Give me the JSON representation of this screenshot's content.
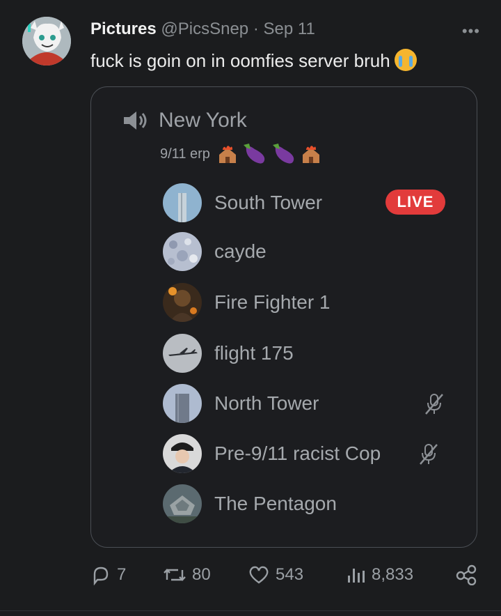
{
  "tweet": {
    "display_name": "Pictures",
    "handle": "@PicsSnep",
    "separator": "·",
    "date": "Sep 11",
    "more_label": "•••",
    "text": "fuck is goin on in oomfies server bruh",
    "text_emoji": "loudly-crying-face"
  },
  "discord": {
    "channel_icon": "speaker-icon",
    "channel_name": "New York",
    "channel_status": "9/11 erp",
    "status_emojis": [
      "house-fire-emoji",
      "eggplant-emoji",
      "eggplant-emoji",
      "house-fire-emoji"
    ],
    "members": [
      {
        "name": "South Tower",
        "badge": "LIVE",
        "muted": false
      },
      {
        "name": "cayde",
        "badge": "",
        "muted": false
      },
      {
        "name": "Fire Fighter 1",
        "badge": "",
        "muted": false
      },
      {
        "name": "flight 175",
        "badge": "",
        "muted": false
      },
      {
        "name": "North Tower",
        "badge": "",
        "muted": true
      },
      {
        "name": "Pre-9/11 racist Cop",
        "badge": "",
        "muted": true
      },
      {
        "name": "The Pentagon",
        "badge": "",
        "muted": false
      }
    ],
    "live_color": "#e23b3b"
  },
  "engagement": {
    "replies": "7",
    "retweets": "80",
    "likes": "543",
    "views": "8,833"
  },
  "colors": {
    "background": "#1b1c1e",
    "muted_text": "#8b8f93",
    "card_border": "#4b4f55"
  }
}
